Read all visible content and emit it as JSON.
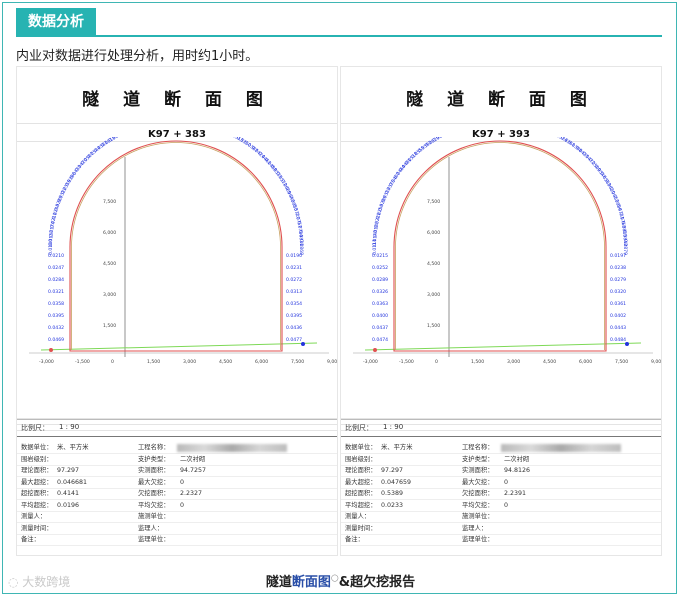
{
  "section": {
    "title": "数据分析",
    "intro": "内业对数据进行处理分析，用时约1小时。"
  },
  "panels": [
    {
      "title": "隧 道 断 面 图",
      "station": "K97 + 383",
      "scale_label": "比例尺：",
      "scale_value": "1 : 90",
      "rows": [
        [
          "数据单位：",
          "米、平方米",
          "工程名称：",
          ""
        ],
        [
          "围岩级别：",
          "",
          "支护类型：",
          "二次衬砌"
        ],
        [
          "理论面积：",
          "97.297",
          "实测面积：",
          "94.7257"
        ],
        [
          "最大超挖：",
          "0.046681",
          "最大欠挖：",
          "0"
        ],
        [
          "超挖面积：",
          "0.4141",
          "欠挖面积：",
          "2.2327"
        ],
        [
          "平均超挖：",
          "0.0196",
          "平均欠挖：",
          "0"
        ],
        [
          "测量人：",
          "",
          "施测单位：",
          ""
        ],
        [
          "测量时间：",
          "",
          "监理人：",
          ""
        ],
        [
          "备注：",
          "",
          "监理单位：",
          ""
        ]
      ]
    },
    {
      "title": "隧 道 断 面 图",
      "station": "K97 + 393",
      "scale_label": "比例尺：",
      "scale_value": "1 : 90",
      "rows": [
        [
          "数据单位：",
          "米、平方米",
          "工程名称：",
          ""
        ],
        [
          "围岩级别：",
          "",
          "支护类型：",
          "二次衬砌"
        ],
        [
          "理论面积：",
          "97.297",
          "实测面积：",
          "94.8126"
        ],
        [
          "最大超挖：",
          "0.047659",
          "最大欠挖：",
          "0"
        ],
        [
          "超挖面积：",
          "0.5389",
          "欠挖面积：",
          "2.2391"
        ],
        [
          "平均超挖：",
          "0.0233",
          "平均欠挖：",
          "0"
        ],
        [
          "测量人：",
          "",
          "施测单位：",
          ""
        ],
        [
          "测量时间：",
          "",
          "监理人：",
          ""
        ],
        [
          "备注：",
          "",
          "监理单位：",
          ""
        ]
      ]
    }
  ],
  "y_ticks": [
    "7,500",
    "6,000",
    "4,500",
    "3,000",
    "1,500"
  ],
  "x_ticks": [
    "-3,000",
    "-1,500",
    "0",
    "1,500",
    "3,000",
    "4,500",
    "6,000",
    "7,500",
    "9,000"
  ],
  "caption": {
    "pre": "隧道",
    "link": "断面图",
    "post": "&超欠挖报告"
  },
  "watermark": "大数跨境",
  "colors": {
    "accent": "#27b3b2",
    "design_line": "#e05050",
    "profile": "#c8a060",
    "labels": "#2233dd",
    "ground": "#7ed957"
  }
}
